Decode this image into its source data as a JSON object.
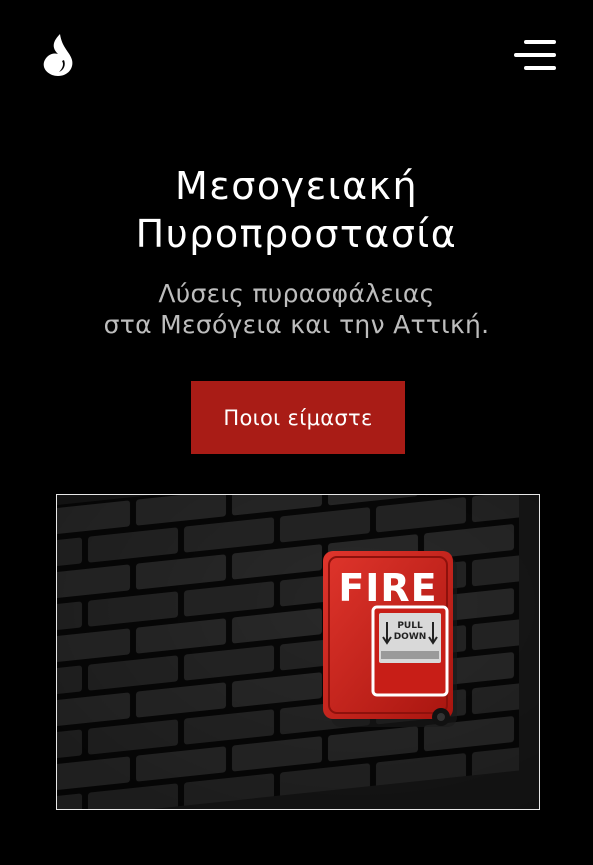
{
  "header": {
    "logo_icon": "flame-logo-icon",
    "menu_icon": "hamburger-menu-icon"
  },
  "hero": {
    "title_line1": "Μεσογειακή",
    "title_line2": "Πυροπροστασία",
    "subtitle_line1": "Λύσεις πυρασφάλειας",
    "subtitle_line2": "στα Μεσόγεια και την Αττική.",
    "cta_label": "Ποιοι είμαστε"
  },
  "image": {
    "alarm_word": "FIRE",
    "alarm_pull": "PULL",
    "alarm_down": "DOWN"
  },
  "colors": {
    "background": "#000000",
    "accent": "#a91c16",
    "subtitle": "#bdbdbd"
  }
}
